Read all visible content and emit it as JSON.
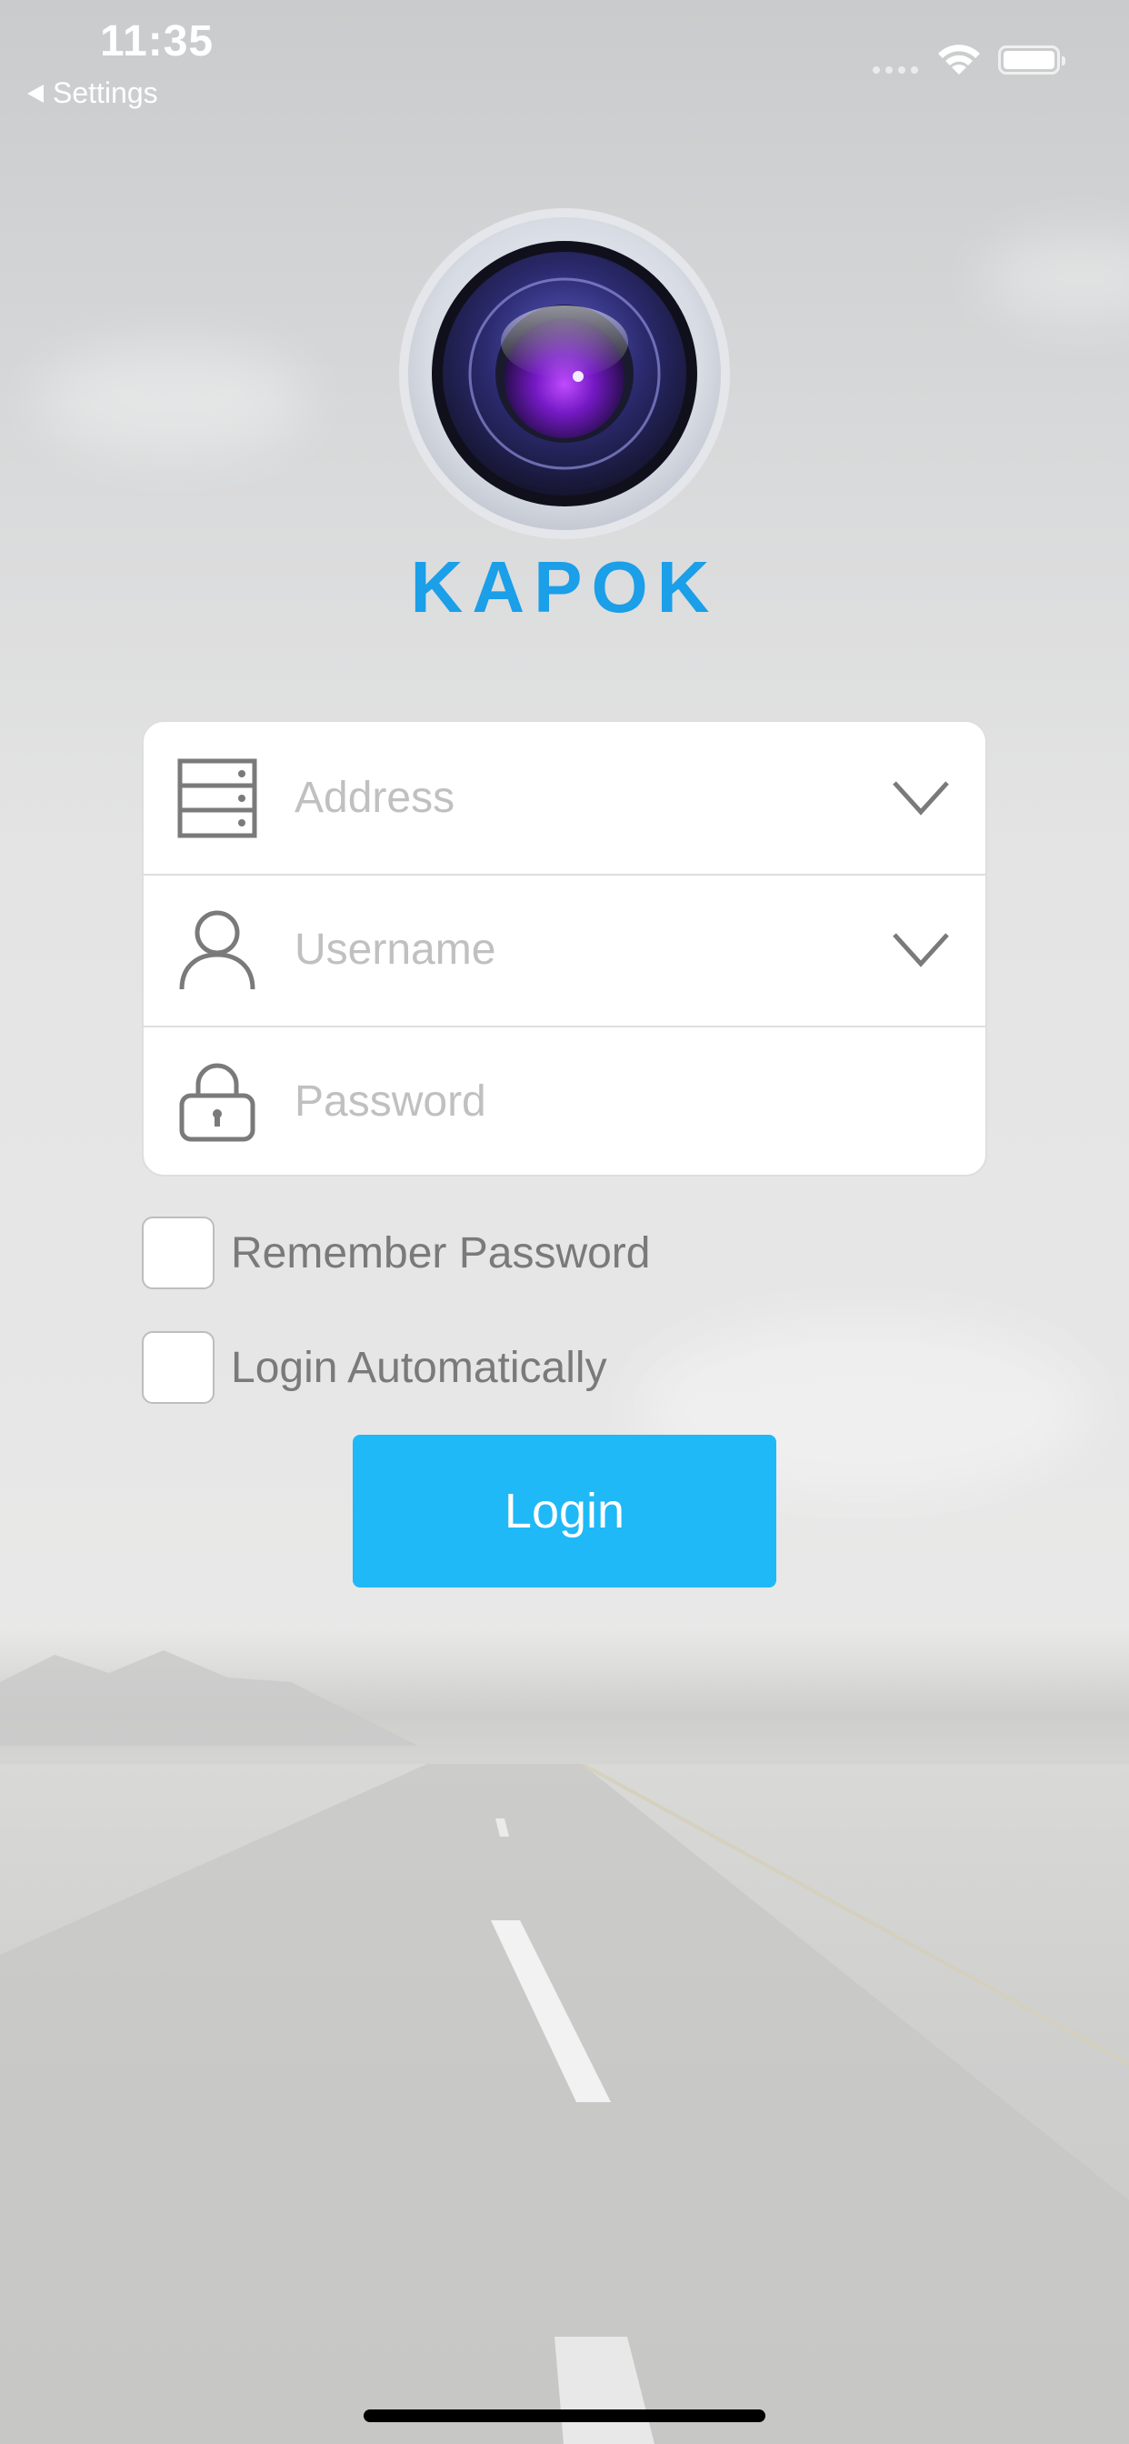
{
  "status_bar": {
    "time": "11:35",
    "back_label": "Settings",
    "wifi_icon": "wifi-icon",
    "battery_icon": "battery-icon"
  },
  "brand": {
    "name": "KAPOK",
    "logo_icon": "camera-lens-icon",
    "color": "#1a9fe8"
  },
  "form": {
    "address": {
      "placeholder": "Address",
      "value": "",
      "icon": "server-icon"
    },
    "username": {
      "placeholder": "Username",
      "value": "",
      "icon": "user-icon"
    },
    "password": {
      "placeholder": "Password",
      "value": "",
      "icon": "lock-icon"
    }
  },
  "options": {
    "remember_password": {
      "label": "Remember Password",
      "checked": false
    },
    "login_automatically": {
      "label": "Login Automatically",
      "checked": false
    }
  },
  "login_button": {
    "label": "Login",
    "color": "#1fb9f7"
  }
}
